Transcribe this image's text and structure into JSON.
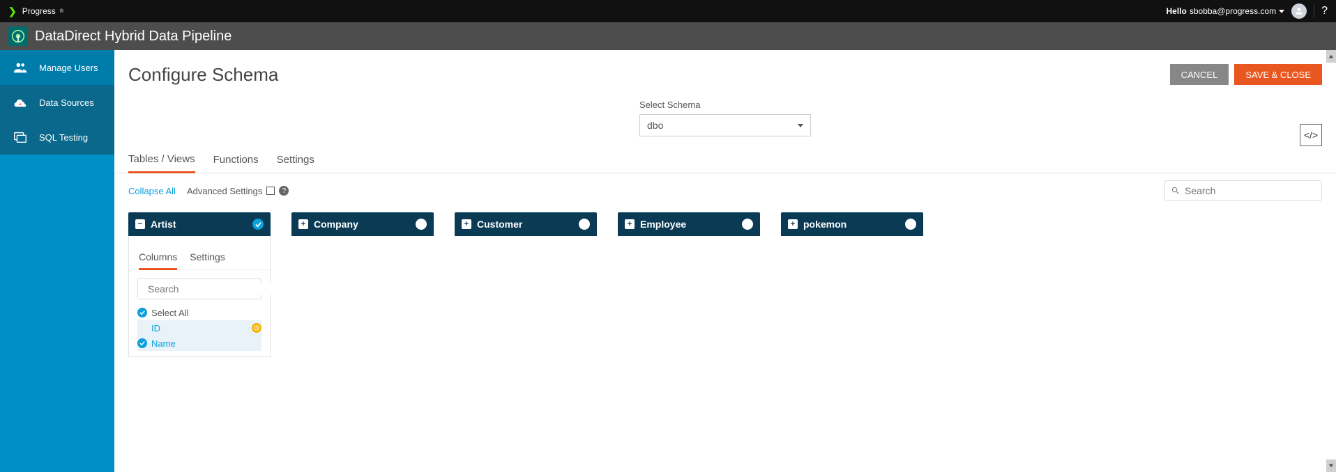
{
  "topbar": {
    "brand": "Progress",
    "hello_label": "Hello",
    "username": "sbobba@progress.com"
  },
  "subheader": {
    "title": "DataDirect Hybrid Data Pipeline"
  },
  "sidebar": {
    "items": [
      {
        "label": "Manage Users"
      },
      {
        "label": "Data Sources"
      },
      {
        "label": "SQL Testing"
      }
    ]
  },
  "page": {
    "title": "Configure Schema",
    "cancel_label": "CANCEL",
    "save_label": "SAVE & CLOSE",
    "schema_label": "Select Schema",
    "schema_selected": "dbo",
    "code_btn": "</>"
  },
  "tabs": [
    {
      "label": "Tables / Views"
    },
    {
      "label": "Functions"
    },
    {
      "label": "Settings"
    }
  ],
  "toolbar": {
    "collapse": "Collapse All",
    "advanced": "Advanced Settings",
    "search_placeholder": "Search"
  },
  "tables": [
    {
      "name": "Artist",
      "expanded": true,
      "selected": true
    },
    {
      "name": "Company",
      "expanded": false,
      "selected": false
    },
    {
      "name": "Customer",
      "expanded": false,
      "selected": false
    },
    {
      "name": "Employee",
      "expanded": false,
      "selected": false
    },
    {
      "name": "pokemon",
      "expanded": false,
      "selected": false
    }
  ],
  "table_detail": {
    "tabs": [
      {
        "label": "Columns"
      },
      {
        "label": "Settings"
      }
    ],
    "search_placeholder": "Search",
    "select_all": "Select All",
    "columns": [
      {
        "name": "ID",
        "selected": false,
        "badge": "clock"
      },
      {
        "name": "Name",
        "selected": true,
        "badge": null
      }
    ]
  }
}
